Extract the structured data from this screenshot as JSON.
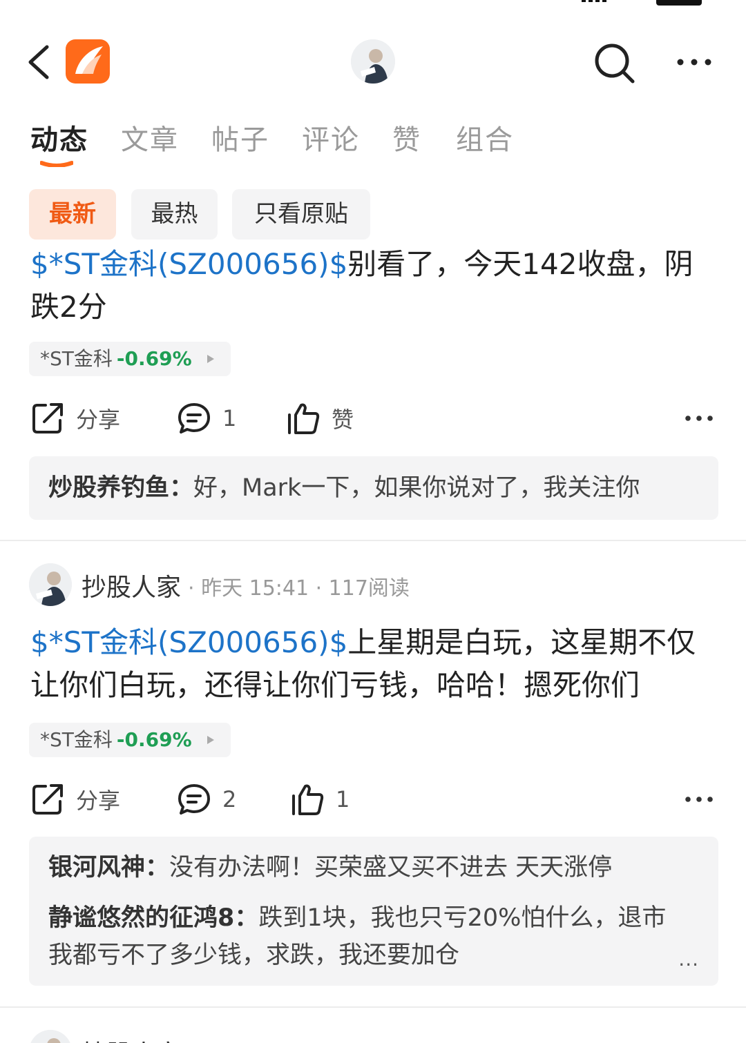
{
  "header": {
    "back_icon": "chevron-left-icon",
    "logo_icon": "app-logo-icon",
    "search_icon": "search-icon",
    "more_icon": "more-horizontal-icon",
    "accent_color": "#ff6a1a"
  },
  "tabs": [
    {
      "label": "动态",
      "active": true
    },
    {
      "label": "文章",
      "active": false
    },
    {
      "label": "帖子",
      "active": false
    },
    {
      "label": "评论",
      "active": false
    },
    {
      "label": "赞",
      "active": false
    },
    {
      "label": "组合",
      "active": false
    }
  ],
  "filters": [
    {
      "label": "最新",
      "active": true
    },
    {
      "label": "最热",
      "active": false
    },
    {
      "label": "只看原贴",
      "active": false
    }
  ],
  "posts": [
    {
      "stock_tag": "$*ST金科(SZ000656)$",
      "text": "别看了，今天142收盘，阴跌2分",
      "stock_chip": {
        "name": "*ST金科",
        "change": "-0.69%"
      },
      "actions": {
        "share_label": "分享",
        "comment_count": "1",
        "like_label": "赞"
      },
      "comments": [
        {
          "author": "炒股养钓鱼：",
          "text": "好，Mark一下，如果你说对了，我关注你"
        }
      ]
    },
    {
      "author": "抄股人家",
      "meta": "· 昨天 15:41 · 117阅读",
      "stock_tag": "$*ST金科(SZ000656)$",
      "text": "上星期是白玩，这星期不仅让你们白玩，还得让你们亏钱，哈哈！摁死你们",
      "stock_chip": {
        "name": "*ST金科",
        "change": "-0.69%"
      },
      "actions": {
        "share_label": "分享",
        "comment_count": "2",
        "like_count": "1"
      },
      "comments": [
        {
          "author": "银河风神：",
          "text": "没有办法啊！买荣盛又买不进去 天天涨停"
        },
        {
          "author": "静谧悠然的征鸿8：",
          "text": "跌到1块，我也只亏20%怕什么，退市我都亏不了多少钱，求跌，我还要加仓"
        }
      ],
      "comments_more": "..."
    },
    {
      "author": "抄股人家"
    }
  ],
  "colors": {
    "stock_link": "#1d73c8",
    "stock_down": "#1f9e54",
    "chip_active_bg": "#fde7dc",
    "chip_active_text": "#f05a14"
  }
}
